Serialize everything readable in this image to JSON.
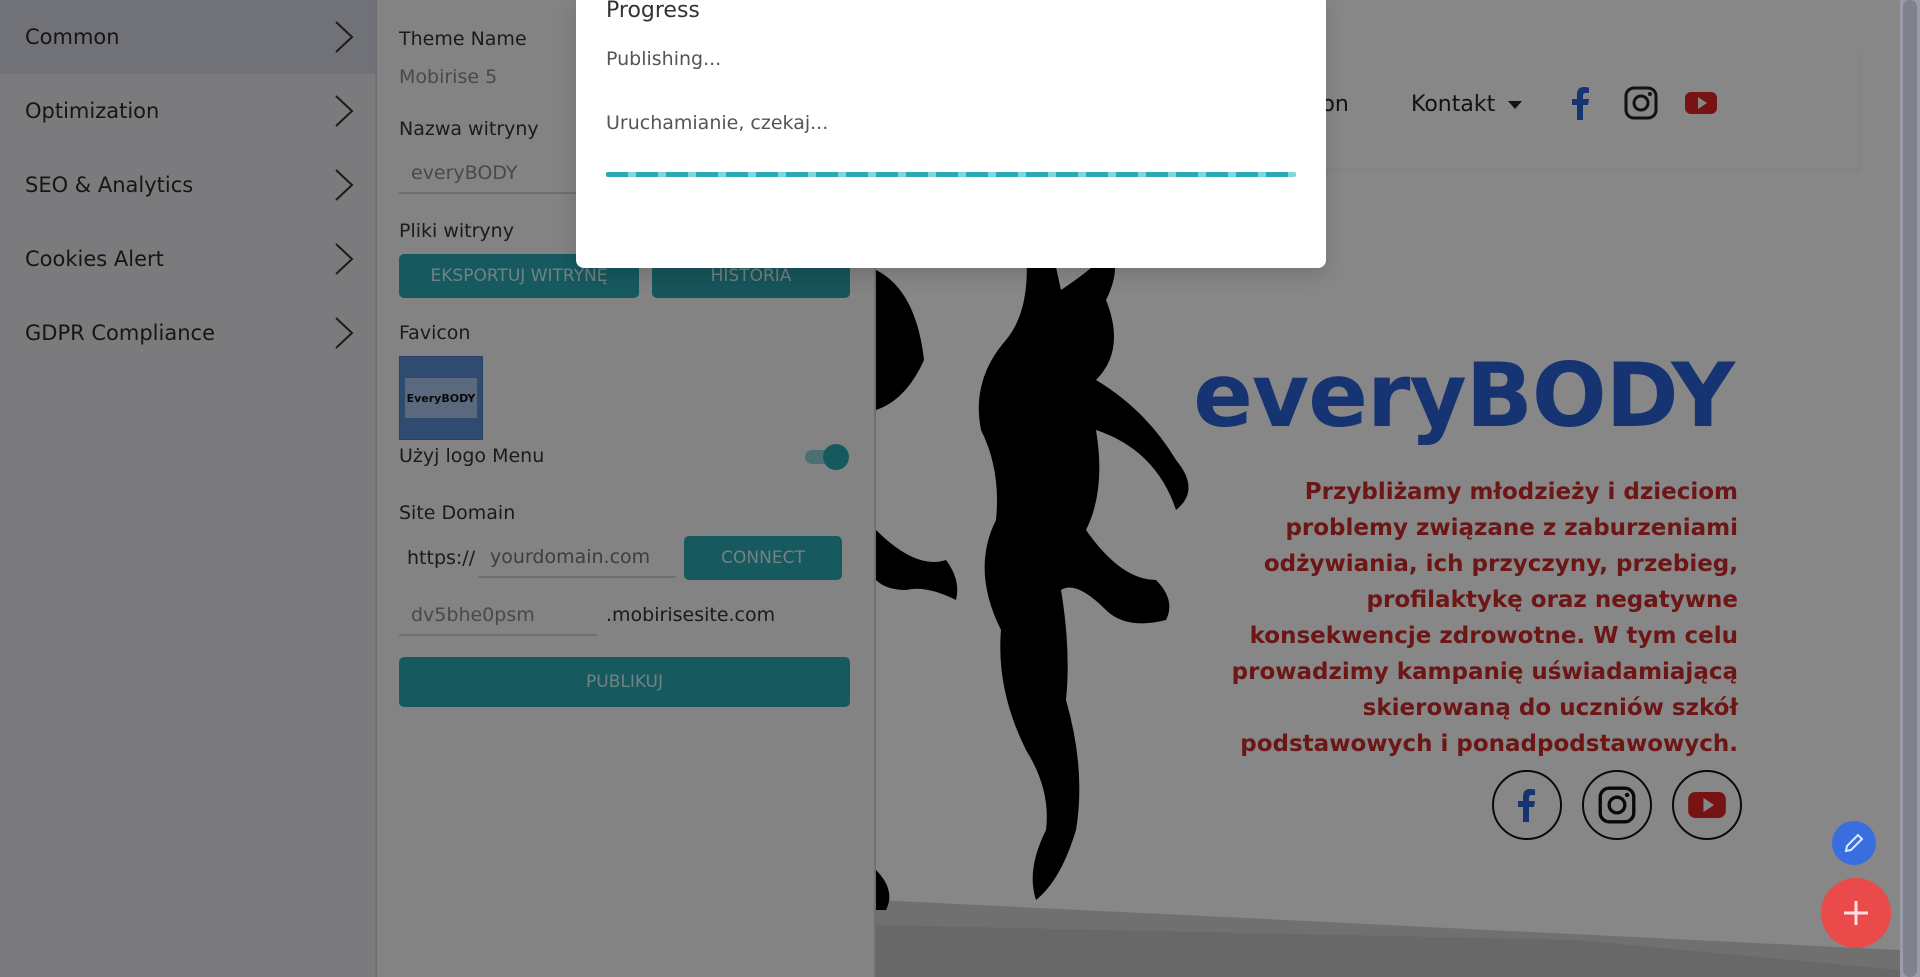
{
  "nav": {
    "items": [
      {
        "label": "Common",
        "active": true
      },
      {
        "label": "Optimization",
        "active": false
      },
      {
        "label": "SEO & Analytics",
        "active": false
      },
      {
        "label": "Cookies Alert",
        "active": false
      },
      {
        "label": "GDPR Compliance",
        "active": false
      }
    ]
  },
  "settings": {
    "theme_name_label": "Theme Name",
    "theme_name_value": "Mobirise 5",
    "site_name_label": "Nazwa witryny",
    "site_name_value": "everyBODY",
    "site_files_label": "Pliki witryny",
    "export_button": "EKSPORTUJ WITRYNĘ",
    "history_button": "HISTORIA",
    "favicon_label": "Favicon",
    "favicon_text": "EveryBODY",
    "use_logo_label": "Użyj logo Menu",
    "use_logo_on": true,
    "site_domain_label": "Site Domain",
    "domain_prefix": "https://",
    "domain_placeholder": "yourdomain.com",
    "connect_button": "CONNECT",
    "subdomain_value": "dv5bhe0psm",
    "subdomain_suffix": ".mobirisesite.com",
    "publish_button": "PUBLIKUJ"
  },
  "preview": {
    "menu_partial": "oon",
    "menu_contact": "Kontakt",
    "hero_title": "everyBODY",
    "hero_text": "Przybliżamy młodzieży i dzieciom problemy związane z zaburzeniami odżywiania, ich przyczyny, przebieg, profilaktykę oraz negatywne konsekwencje zdrowotne. W tym celu prowadzimy kampanię uświadamiającą skierowaną do uczniów szkół podstawowych i ponadpodstawowych.",
    "social_icons": [
      "facebook-icon",
      "instagram-icon",
      "youtube-icon"
    ],
    "colors": {
      "title": "#2d62d8",
      "text": "#cf2a2a",
      "accent": "#2aa8b4"
    }
  },
  "modal": {
    "title": "Progress",
    "subtitle": "Publishing...",
    "message": "Uruchamianie, czekaj...",
    "progress": 1.0
  }
}
